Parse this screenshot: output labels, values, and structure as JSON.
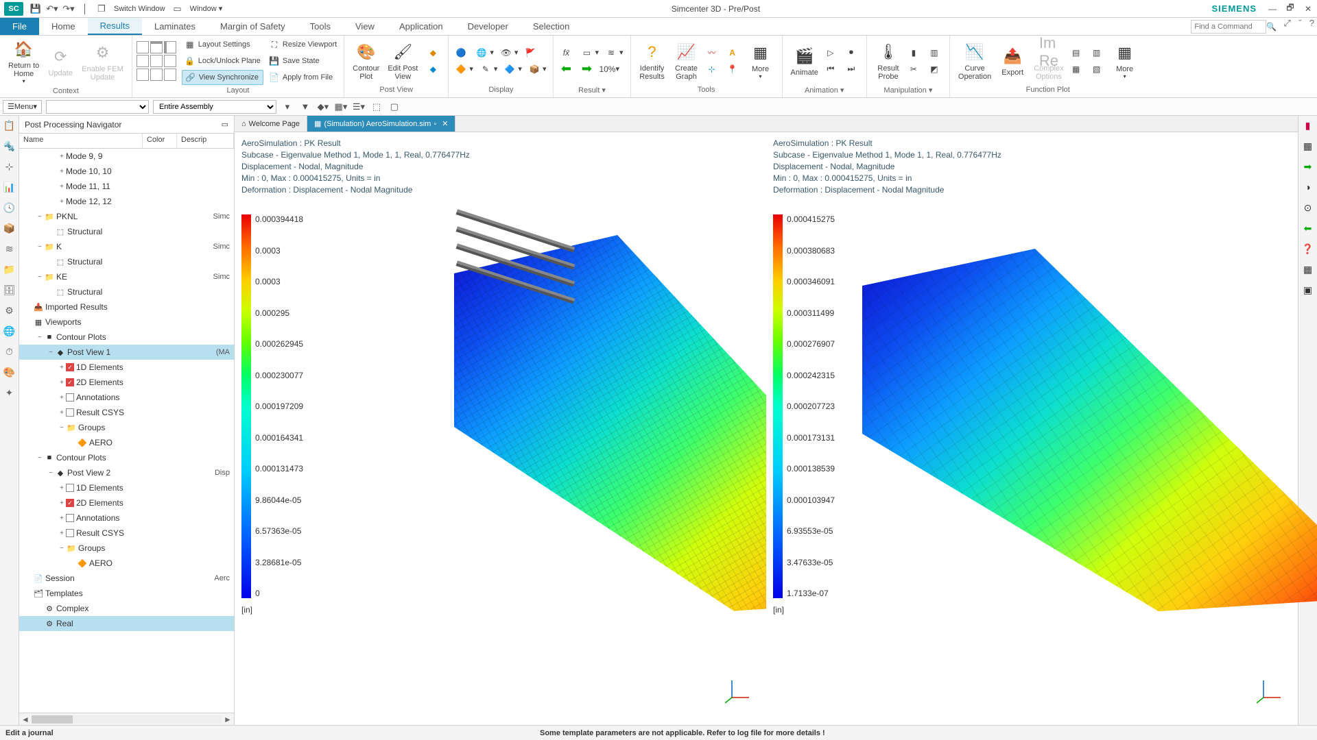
{
  "app": {
    "title": "Simcenter 3D - Pre/Post",
    "brand": "SIEMENS",
    "logo": "SC"
  },
  "qat": {
    "switch_window": "Switch Window",
    "window_menu": "Window"
  },
  "ribbon_tabs": {
    "file": "File",
    "items": [
      "Home",
      "Results",
      "Laminates",
      "Margin of Safety",
      "Tools",
      "View",
      "Application",
      "Developer",
      "Selection"
    ],
    "active_index": 1,
    "search_placeholder": "Find a Command"
  },
  "ribbon": {
    "context": {
      "label": "Context",
      "return_home": "Return to\nHome",
      "update": "Update",
      "enable_fem": "Enable FEM\nUpdate"
    },
    "layout": {
      "label": "Layout",
      "layout_settings": "Layout Settings",
      "resize_viewport": "Resize Viewport",
      "lock_unlock": "Lock/Unlock Plane",
      "save_state": "Save State",
      "view_sync": "View Synchronize",
      "apply_file": "Apply from File"
    },
    "postview": {
      "label": "Post View",
      "contour": "Contour\nPlot",
      "edit": "Edit Post\nView"
    },
    "display": {
      "label": "Display"
    },
    "result": {
      "label": "Result"
    },
    "tools": {
      "label": "Tools",
      "identify": "Identify\nResults",
      "create_graph": "Create\nGraph",
      "more": "More"
    },
    "animation": {
      "label": "Animation",
      "animate": "Animate"
    },
    "manipulation": {
      "label": "Manipulation",
      "probe": "Result\nProbe"
    },
    "functionplot": {
      "label": "Function Plot",
      "curve": "Curve\nOperation",
      "export": "Export",
      "complex": "Complex\nOptions",
      "more": "More"
    }
  },
  "toolbar2": {
    "menu": "Menu",
    "assembly": "Entire Assembly"
  },
  "navigator": {
    "title": "Post Processing Navigator",
    "headers": {
      "name": "Name",
      "color": "Color",
      "descrip": "Descrip"
    },
    "tree": [
      {
        "indent": 3,
        "exp": "+",
        "label": "Mode 9, 9"
      },
      {
        "indent": 3,
        "exp": "+",
        "label": "Mode 10, 10"
      },
      {
        "indent": 3,
        "exp": "+",
        "label": "Mode 11, 11"
      },
      {
        "indent": 3,
        "exp": "+",
        "label": "Mode 12, 12"
      },
      {
        "indent": 1,
        "exp": "−",
        "icon": "📁",
        "label": "PKNL",
        "desc": "Simc"
      },
      {
        "indent": 2,
        "exp": "",
        "icon": "⬚",
        "label": "Structural"
      },
      {
        "indent": 1,
        "exp": "−",
        "icon": "📁",
        "label": "K",
        "desc": "Simc"
      },
      {
        "indent": 2,
        "exp": "",
        "icon": "⬚",
        "label": "Structural"
      },
      {
        "indent": 1,
        "exp": "−",
        "icon": "📁",
        "label": "KE",
        "desc": "Simc"
      },
      {
        "indent": 2,
        "exp": "",
        "icon": "⬚",
        "label": "Structural"
      },
      {
        "indent": 0,
        "exp": "",
        "icon": "📥",
        "label": "Imported Results"
      },
      {
        "indent": 0,
        "exp": "",
        "icon": "▦",
        "label": "Viewports"
      },
      {
        "indent": 1,
        "exp": "−",
        "icon": "■",
        "label": "Contour Plots"
      },
      {
        "indent": 2,
        "exp": "−",
        "icon": "◆",
        "label": "Post View 1",
        "desc": "(MA",
        "selected": true
      },
      {
        "indent": 3,
        "exp": "+",
        "chk": true,
        "label": "1D Elements"
      },
      {
        "indent": 3,
        "exp": "+",
        "chk": true,
        "label": "2D Elements"
      },
      {
        "indent": 3,
        "exp": "+",
        "chk": false,
        "label": "Annotations"
      },
      {
        "indent": 3,
        "exp": "+",
        "chk": false,
        "label": "Result CSYS"
      },
      {
        "indent": 3,
        "exp": "−",
        "icon": "📁",
        "label": "Groups"
      },
      {
        "indent": 4,
        "exp": "",
        "icon": "🔶",
        "label": "AERO"
      },
      {
        "indent": 1,
        "exp": "−",
        "icon": "■",
        "label": "Contour Plots"
      },
      {
        "indent": 2,
        "exp": "−",
        "icon": "◆",
        "label": "Post View 2",
        "desc": "Disp"
      },
      {
        "indent": 3,
        "exp": "+",
        "chk": false,
        "label": "1D Elements"
      },
      {
        "indent": 3,
        "exp": "+",
        "chk": true,
        "label": "2D Elements"
      },
      {
        "indent": 3,
        "exp": "+",
        "chk": false,
        "label": "Annotations"
      },
      {
        "indent": 3,
        "exp": "+",
        "chk": false,
        "label": "Result CSYS"
      },
      {
        "indent": 3,
        "exp": "−",
        "icon": "📁",
        "label": "Groups"
      },
      {
        "indent": 4,
        "exp": "",
        "icon": "🔶",
        "label": "AERO"
      },
      {
        "indent": 0,
        "exp": "",
        "icon": "📄",
        "label": "Session",
        "desc": "Aerc"
      },
      {
        "indent": 0,
        "exp": "",
        "icon": "🗂",
        "label": "Templates"
      },
      {
        "indent": 1,
        "exp": "",
        "icon": "⚙",
        "label": "Complex"
      },
      {
        "indent": 1,
        "exp": "",
        "icon": "⚙",
        "label": "Real",
        "selected": true
      }
    ]
  },
  "doc_tabs": [
    {
      "icon": "⌂",
      "label": "Welcome Page",
      "active": false
    },
    {
      "icon": "▦",
      "label": "(Simulation) AeroSimulation.sim",
      "active": true,
      "closable": true
    }
  ],
  "viewport_info": {
    "l1": "AeroSimulation : PK Result",
    "l2": "Subcase - Eigenvalue Method 1, Mode 1, 1, Real, 0.776477Hz",
    "l3": "Displacement - Nodal, Magnitude",
    "l4": "Min : 0, Max : 0.000415275, Units = in",
    "l5": "Deformation : Displacement - Nodal Magnitude"
  },
  "legend1": {
    "ticks": [
      "0.000394418",
      "0.0003",
      "0.0003",
      "0.000295",
      "0.000262945",
      "0.000230077",
      "0.000197209",
      "0.000164341",
      "0.000131473",
      "9.86044e-05",
      "6.57363e-05",
      "3.28681e-05",
      "0"
    ],
    "unit": "[in]"
  },
  "legend2": {
    "ticks": [
      "0.000415275",
      "0.000380683",
      "0.000346091",
      "0.000311499",
      "0.000276907",
      "0.000242315",
      "0.000207723",
      "0.000173131",
      "0.000138539",
      "0.000103947",
      "6.93553e-05",
      "3.47633e-05",
      "1.7133e-07"
    ],
    "unit": "[in]"
  },
  "status": {
    "left": "Edit a journal",
    "center": "Some template parameters are not applicable. Refer to log file for more details !"
  }
}
